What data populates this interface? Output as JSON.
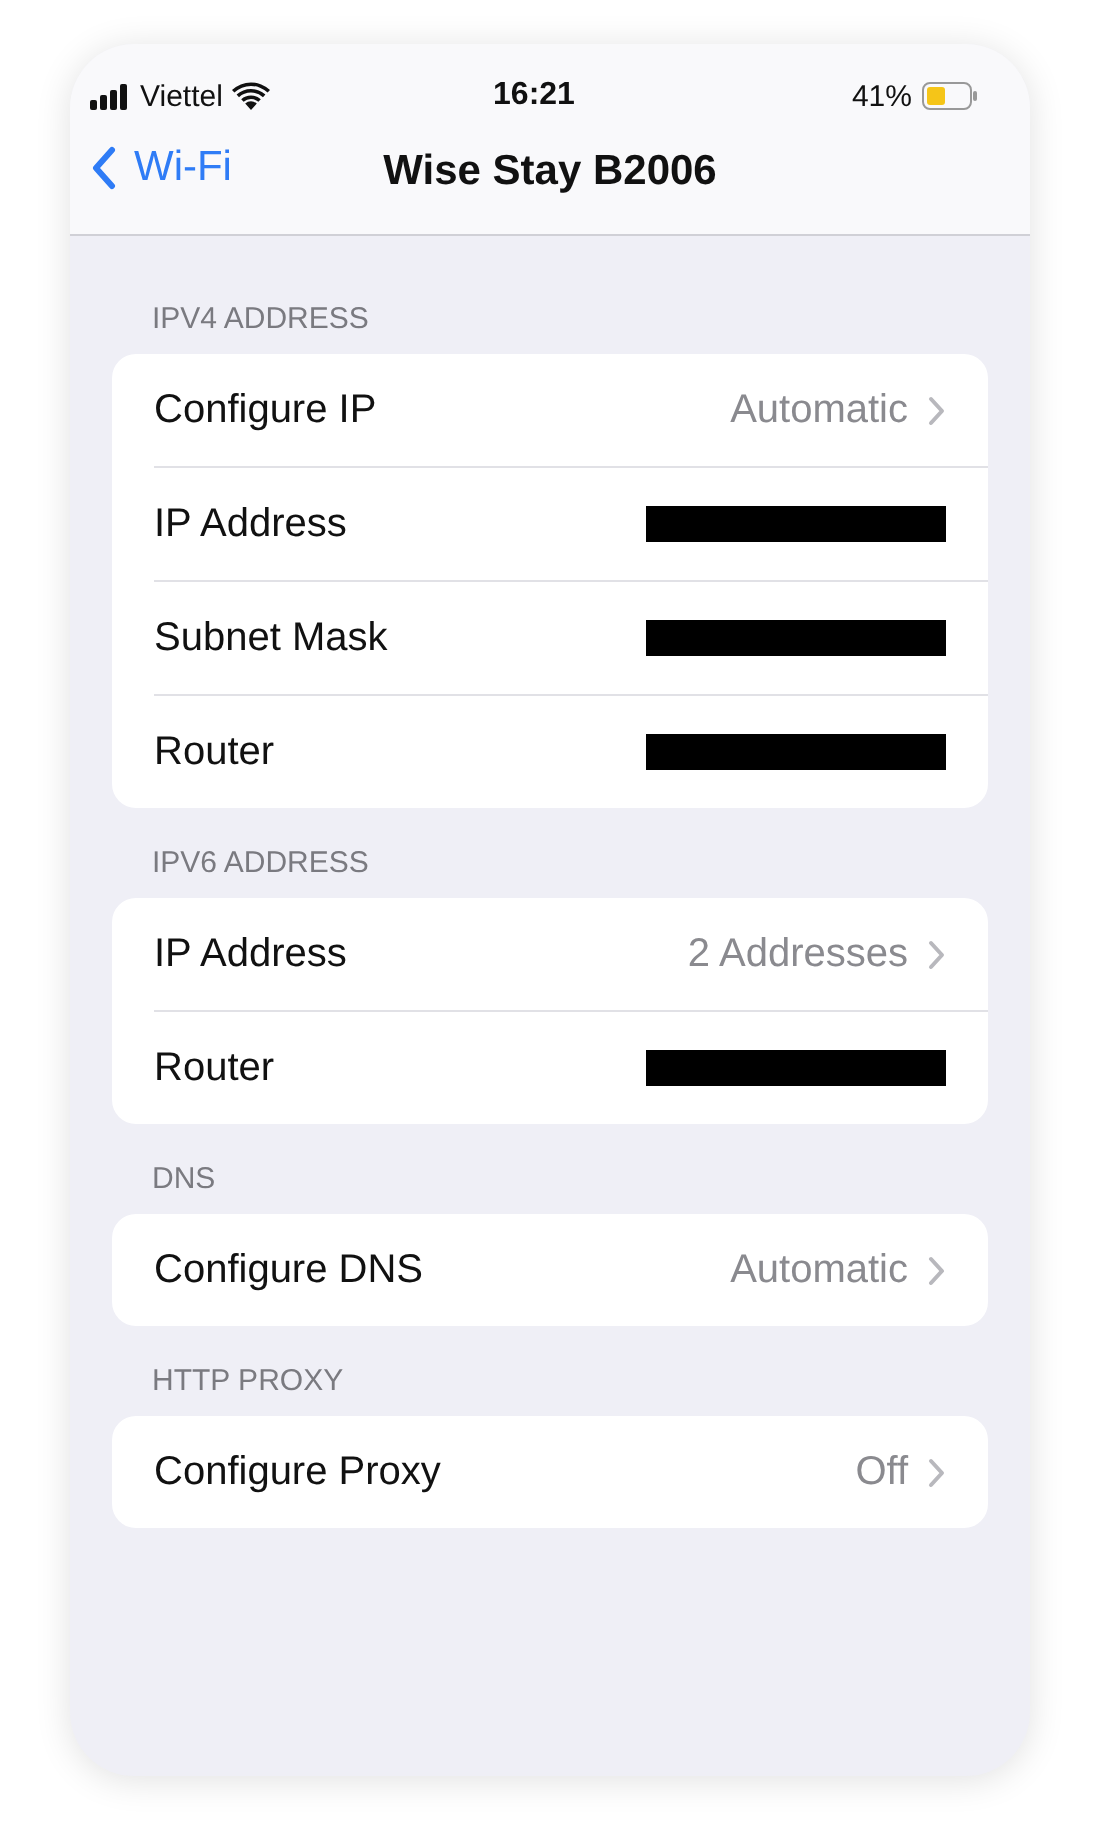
{
  "status_bar": {
    "carrier": "Viettel",
    "time": "16:21",
    "battery": "41%"
  },
  "nav": {
    "back": "Wi-Fi",
    "title": "Wise Stay B2006"
  },
  "sections": [
    {
      "header": "IPV4 ADDRESS",
      "rows": [
        {
          "label": "Configure IP",
          "kind": "link",
          "value": "Automatic"
        },
        {
          "label": "IP Address",
          "kind": "redacted"
        },
        {
          "label": "Subnet Mask",
          "kind": "redacted"
        },
        {
          "label": "Router",
          "kind": "redacted"
        }
      ]
    },
    {
      "header": "IPV6 ADDRESS",
      "rows": [
        {
          "label": "IP Address",
          "kind": "link",
          "value": "2 Addresses"
        },
        {
          "label": "Router",
          "kind": "redacted"
        }
      ]
    },
    {
      "header": "DNS",
      "rows": [
        {
          "label": "Configure DNS",
          "kind": "link",
          "value": "Automatic"
        }
      ]
    },
    {
      "header": "HTTP PROXY",
      "rows": [
        {
          "label": "Configure Proxy",
          "kind": "link",
          "value": "Off"
        }
      ]
    }
  ]
}
